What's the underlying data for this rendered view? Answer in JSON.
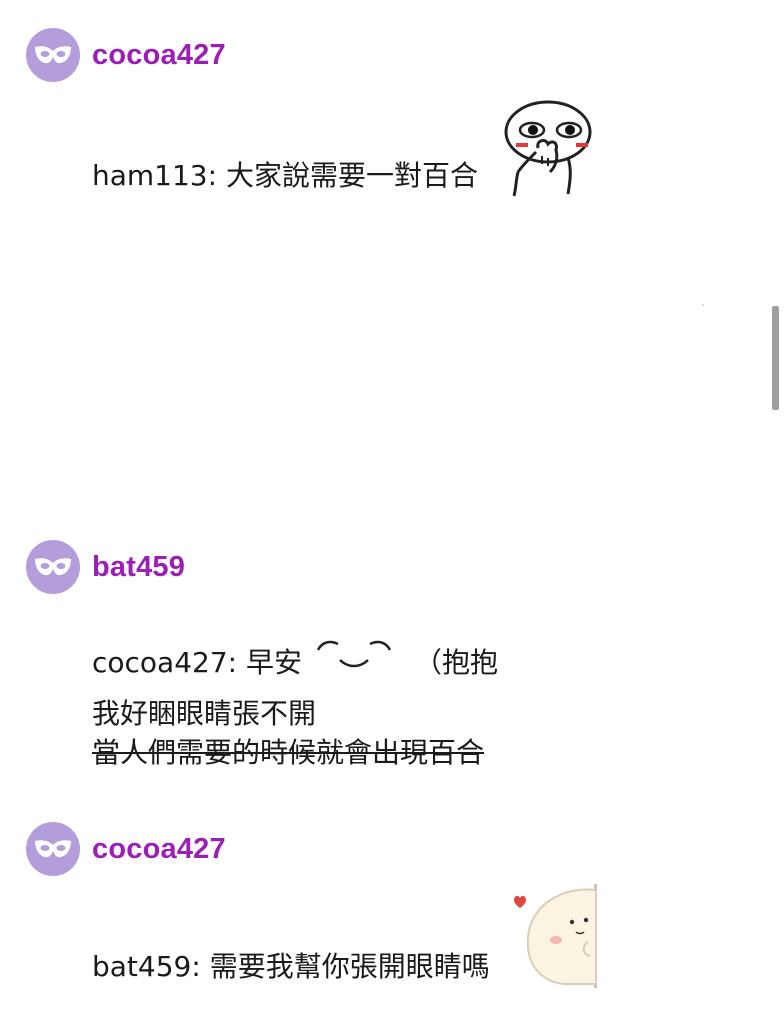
{
  "colors": {
    "accent": "#9b1fb5",
    "avatar_bg": "#b39ddb",
    "text": "#1a1a1a",
    "scrollbar": "#9e9e9e"
  },
  "posts": [
    {
      "username": "cocoa427",
      "avatar_icon": "mask-icon",
      "lines": [
        "ham113: 大家說需要一對百合"
      ],
      "sticker": "shy-face-sticker"
    },
    {
      "username": "bat459",
      "avatar_icon": "mask-icon",
      "line1_text": "cocoa427: 早安",
      "line1_suffix": "（抱抱",
      "line2": "我好睏眼睛張不開",
      "line3_strike": "當人們需要的時候就會出現百合",
      "emoticon": "smile-eyes-emoticon"
    },
    {
      "username": "cocoa427",
      "avatar_icon": "mask-icon",
      "lines": [
        "bat459: 需要我幫你張開眼睛嗎"
      ],
      "sticker": "peeking-ghost-sticker"
    }
  ]
}
